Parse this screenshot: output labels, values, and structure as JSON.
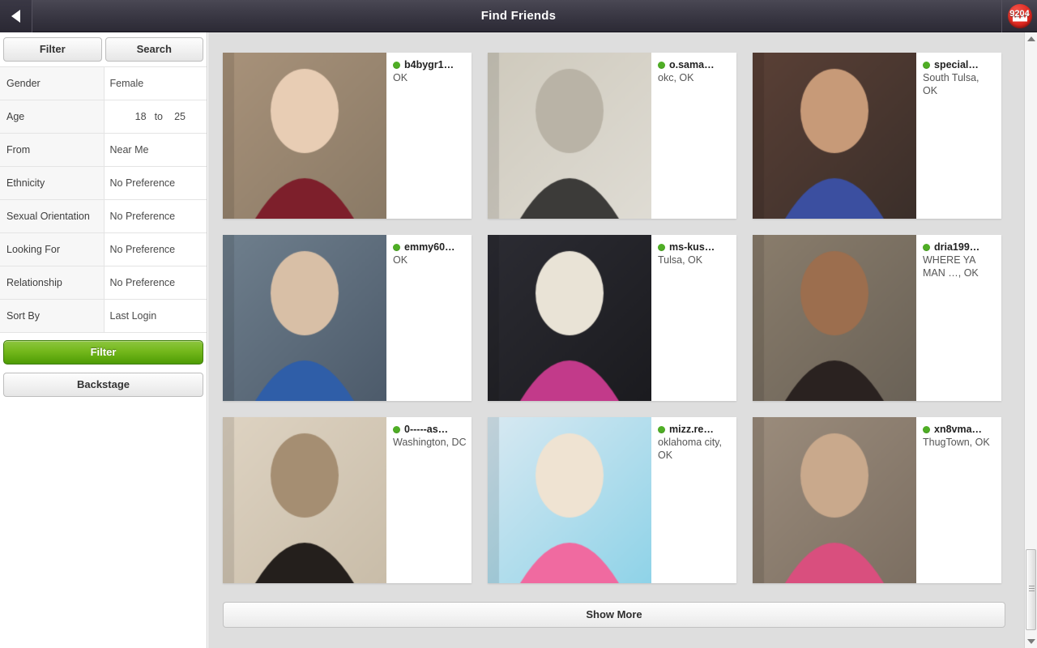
{
  "topbar": {
    "back_icon": "chevron-left-icon",
    "title": "Find Friends",
    "badge": {
      "icon": "crown-icon",
      "count": "9204",
      "color": "#e02a22"
    }
  },
  "sidebar": {
    "tabs": [
      {
        "label": "Filter",
        "active": true
      },
      {
        "label": "Search",
        "active": false
      }
    ],
    "filters": [
      {
        "label": "Gender",
        "value": "Female"
      },
      {
        "label": "Age",
        "value": "18 to 25",
        "age_min": "18",
        "age_sep": "to",
        "age_max": "25"
      },
      {
        "label": "From",
        "value": "Near Me"
      },
      {
        "label": "Ethnicity",
        "value": "No Preference"
      },
      {
        "label": "Sexual Orientation",
        "value": "No Preference"
      },
      {
        "label": "Looking For",
        "value": "No Preference"
      },
      {
        "label": "Relationship",
        "value": "No Preference"
      },
      {
        "label": "Sort By",
        "value": "Last Login"
      }
    ],
    "primary_button": {
      "label": "Filter",
      "color": "#74b81c"
    },
    "secondary_button": {
      "label": "Backstage"
    }
  },
  "results": {
    "cards": [
      {
        "name": "b4bygr1…",
        "location": "OK",
        "status": "online"
      },
      {
        "name": "o.sama…",
        "location": "okc, OK",
        "status": "online"
      },
      {
        "name": "special…",
        "location": "South Tulsa, OK",
        "status": "online"
      },
      {
        "name": "emmy60…",
        "location": "OK",
        "status": "online"
      },
      {
        "name": "ms-kus…",
        "location": "Tulsa, OK",
        "status": "online"
      },
      {
        "name": "dria199…",
        "location": "WHERE YA MAN …, OK",
        "status": "online"
      },
      {
        "name": "0-----as…",
        "location": "Washington, DC",
        "status": "online"
      },
      {
        "name": "mizz.re…",
        "location": "oklahoma city, OK",
        "status": "online"
      },
      {
        "name": "xn8vma…",
        "location": "ThugTown, OK",
        "status": "online"
      }
    ],
    "show_more_label": "Show More"
  },
  "scrollbar": {
    "up_icon": "triangle-up-icon",
    "down_icon": "triangle-down-icon"
  }
}
